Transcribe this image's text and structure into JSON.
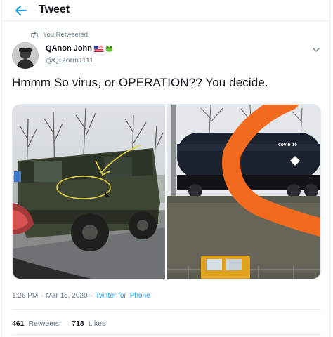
{
  "header": {
    "title": "Tweet"
  },
  "retweet": {
    "label": "You Retweeted"
  },
  "author": {
    "display_name": "QAnon John",
    "handle": "@QStorm1111",
    "badges": [
      "us-flag-icon",
      "frog-icon"
    ]
  },
  "tweet": {
    "text": "Hmmm So virus, or OPERATION?? You decide."
  },
  "media": {
    "images": [
      {
        "name": "military-humvee-photo",
        "annotation_color": "#e6d43a"
      },
      {
        "name": "tanker-train-photo",
        "tank_label": "COVID-19",
        "annotation_color": "#f26a1e"
      }
    ]
  },
  "meta": {
    "time": "1:26 PM",
    "separator": "·",
    "date": "Mar 15, 2020",
    "source": "Twitter for iPhone"
  },
  "stats": {
    "retweets_count": "461",
    "retweets_label": "Retweets",
    "likes_count": "718",
    "likes_label": "Likes"
  },
  "colors": {
    "accent": "#1da1f2",
    "muted": "#657786",
    "text": "#14171a",
    "border": "#e6ecf0"
  }
}
